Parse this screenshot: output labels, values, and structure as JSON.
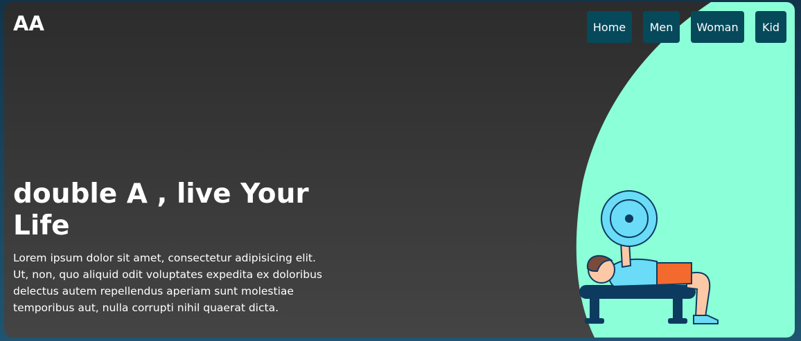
{
  "brand": {
    "logo_text": "AA"
  },
  "nav": {
    "items": [
      {
        "label": "Home"
      },
      {
        "label": "Men"
      },
      {
        "label": "Woman"
      },
      {
        "label": "Kid"
      }
    ]
  },
  "hero": {
    "headline": "double A , live Your Life",
    "body": "Lorem ipsum dolor sit amet, consectetur adipisicing elit. Ut, non, quo aliquid odit voluptates expedita ex doloribus delectus autem repellendus aperiam sunt molestiae temporibus aut, nulla corrupti nihil quaerat dicta."
  },
  "colors": {
    "background_dark": "#2c2c2c",
    "accent_mint": "#8affd8",
    "nav_button": "#05495a",
    "plate_blue": "#6adcf7",
    "navy": "#0d3a5f",
    "shorts": "#f26a2e",
    "skin": "#fcc8a6"
  },
  "illustration": {
    "icon": "weightlifter-bench-press-icon"
  }
}
